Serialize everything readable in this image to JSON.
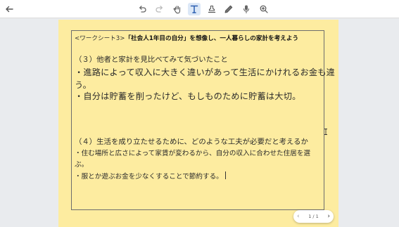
{
  "toolbar": {
    "tools": [
      {
        "name": "undo-icon"
      },
      {
        "name": "redo-icon"
      },
      {
        "name": "hand-icon"
      },
      {
        "name": "text-icon",
        "active": true
      },
      {
        "name": "stamp-icon"
      },
      {
        "name": "pen-icon"
      },
      {
        "name": "microphone-icon"
      },
      {
        "name": "zoom-icon"
      }
    ]
  },
  "document": {
    "heading_prefix": "<ワークシート3>",
    "heading_bold": "「社会人1年目の自分」を想像し、一人暮らしの家計を考えよう",
    "q3": "（３）他者と家計を見比べてみて気づいたこと",
    "q3_line1": "・進路によって収入に大きく違いがあって生活にかけれるお金も違",
    "q3_line2": "う。",
    "q3_line3": "・自分は貯蓄を削ったけど、もしものために貯蓄は大切。",
    "q4": "（４）生活を成り立たせるために、どのような工夫が必要だと考えるか",
    "q4_line1": "・住む場所と広さによって家賃が変わるから、自分の収入に合わせた住居を選",
    "q4_line2": "ぶ。",
    "q4_line3": "・服とか遊ぶお金を少なくすることで節約する。"
  },
  "pager": {
    "label": "1 / 1",
    "prev": "‹",
    "next": "›"
  },
  "colors": {
    "page_bg": "#fdeca0",
    "app_bg": "#e9ebee",
    "active_tool": "#dce8f7"
  }
}
